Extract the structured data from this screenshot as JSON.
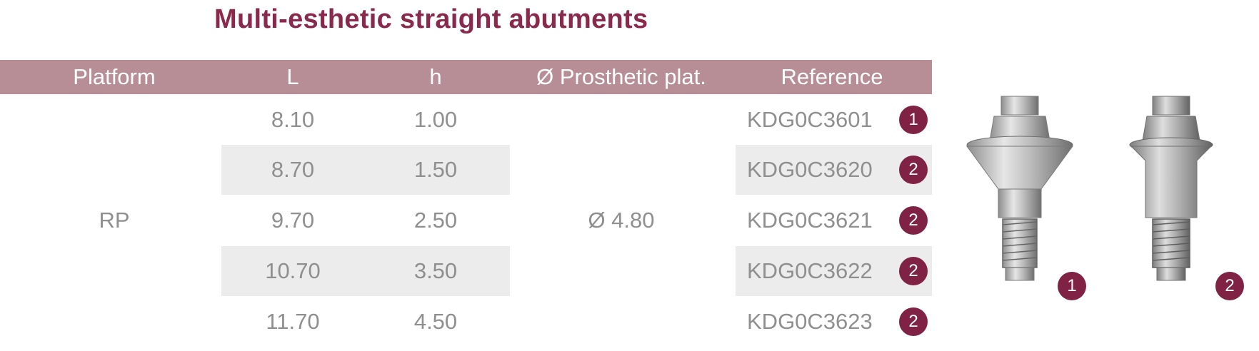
{
  "title": "Multi-esthetic straight abutments",
  "table": {
    "headers": [
      "Platform",
      "L",
      "h",
      "Ø Prosthetic plat.",
      "Reference"
    ],
    "platform": "RP",
    "prosthetic_platform": "Ø 4.80",
    "rows": [
      {
        "L": "8.10",
        "h": "1.00",
        "reference": "KDG0C3601",
        "model": "1"
      },
      {
        "L": "8.70",
        "h": "1.50",
        "reference": "KDG0C3620",
        "model": "2"
      },
      {
        "L": "9.70",
        "h": "2.50",
        "reference": "KDG0C3621",
        "model": "2"
      },
      {
        "L": "10.70",
        "h": "3.50",
        "reference": "KDG0C3622",
        "model": "2"
      },
      {
        "L": "11.70",
        "h": "4.50",
        "reference": "KDG0C3623",
        "model": "2"
      }
    ]
  },
  "products": [
    {
      "label": "1",
      "icon": "abutment-wide-image"
    },
    {
      "label": "2",
      "icon": "abutment-narrow-image"
    }
  ],
  "colors": {
    "title": "#8a2a4a",
    "header_band": "#b88e96",
    "row_shade": "#ececec",
    "badge": "#7f2244",
    "cell_text": "#8f8f8f"
  }
}
